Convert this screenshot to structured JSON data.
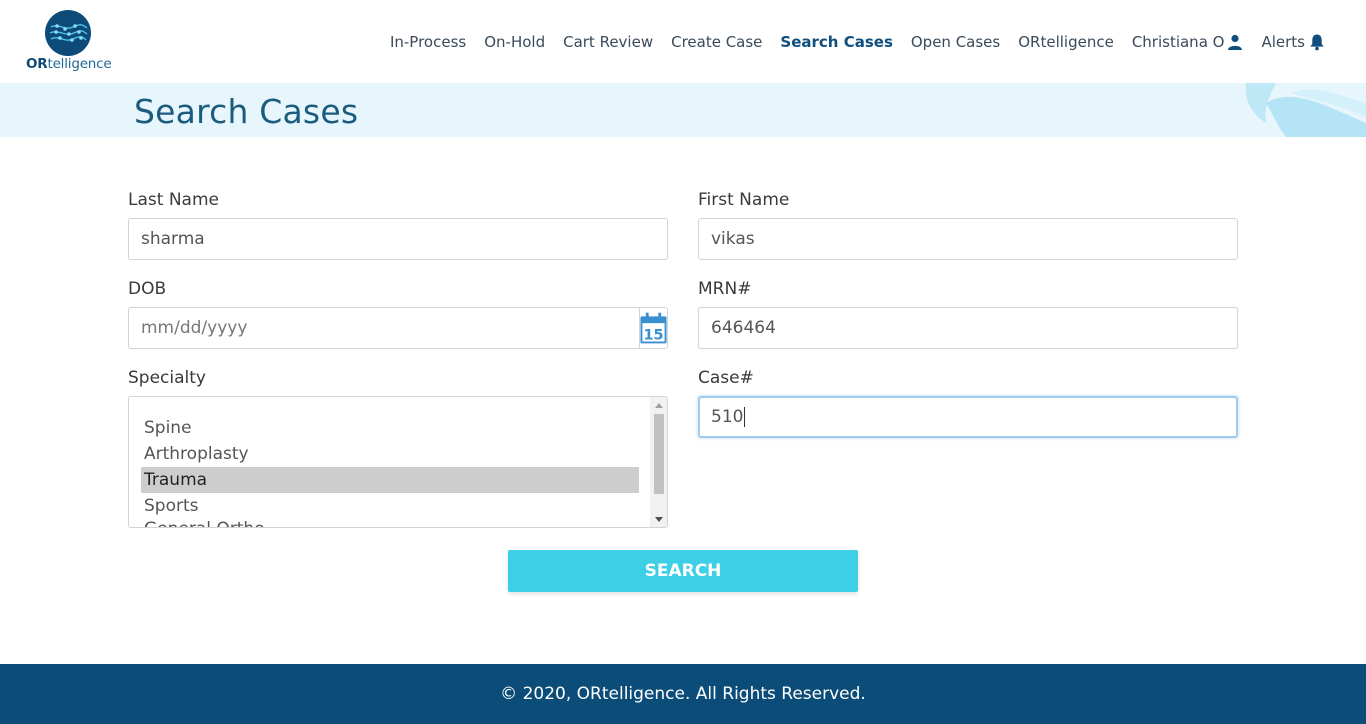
{
  "header": {
    "logo_text_bold": "OR",
    "logo_text_rest": "telligence",
    "nav": [
      {
        "label": "In-Process"
      },
      {
        "label": "On-Hold"
      },
      {
        "label": "Cart Review"
      },
      {
        "label": "Create Case"
      },
      {
        "label": "Search Cases",
        "active": true
      },
      {
        "label": "Open Cases"
      },
      {
        "label": "ORtelligence"
      },
      {
        "label": "Christiana O",
        "icon": "user-icon"
      },
      {
        "label": "Alerts",
        "icon": "bell-icon"
      }
    ]
  },
  "page": {
    "title": "Search Cases"
  },
  "form": {
    "last_name": {
      "label": "Last Name",
      "value": "sharma"
    },
    "first_name": {
      "label": "First Name",
      "value": "vikas"
    },
    "dob": {
      "label": "DOB",
      "placeholder": "mm/dd/yyyy",
      "calendar_day": "15"
    },
    "mrn": {
      "label": "MRN#",
      "value": "646464"
    },
    "specialty": {
      "label": "Specialty",
      "options": [
        "Spine",
        "Arthroplasty",
        "Trauma",
        "Sports",
        "General Ortho"
      ],
      "selected": "Trauma"
    },
    "case_no": {
      "label": "Case#",
      "value": "510"
    },
    "search_button": "SEARCH"
  },
  "footer": {
    "text": "© 2020, ORtelligence. All Rights Reserved."
  },
  "colors": {
    "primary_dark": "#0b4d78",
    "accent_cyan": "#3ccfe6",
    "title_band": "#e7f6fc",
    "calendar_blue": "#3a8fd0"
  }
}
